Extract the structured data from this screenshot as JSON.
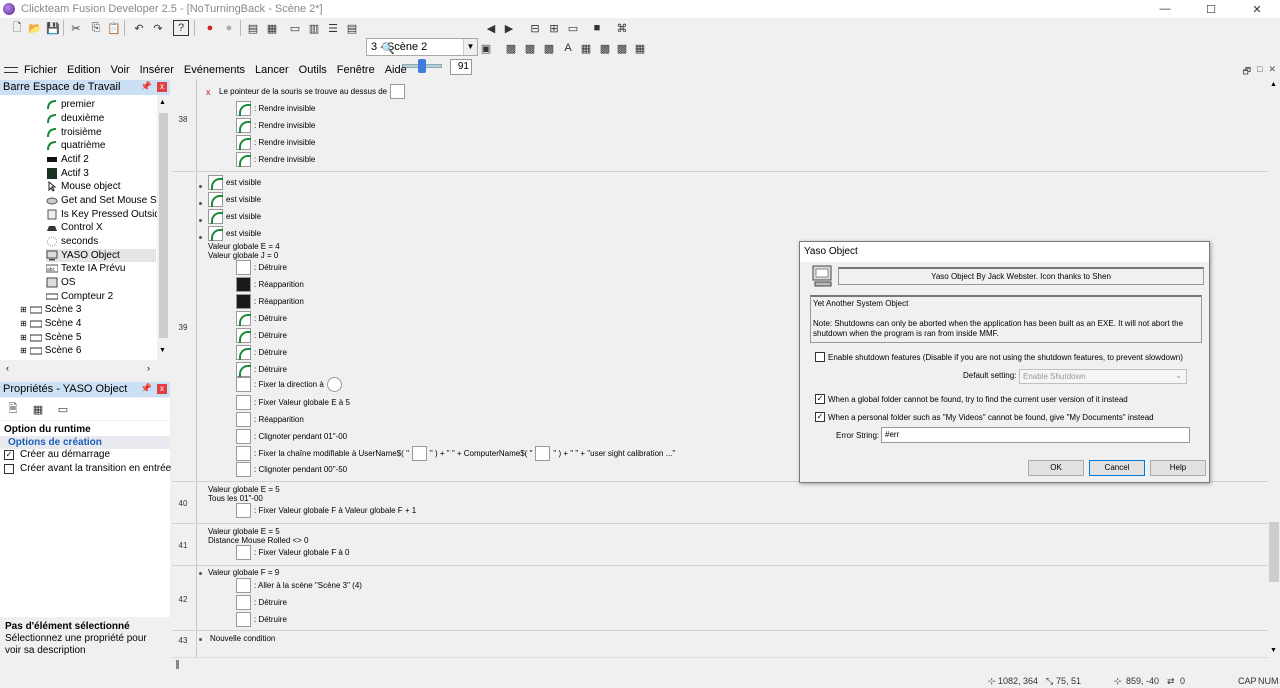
{
  "window": {
    "title": "Clickteam Fusion Developer 2.5 - [NoTurningBack - Scène 2*]",
    "minimize": "—",
    "maximize": "☐",
    "close": "✕"
  },
  "toolbar": {
    "scene_selector": "3 - Scène 2",
    "zoom_value": "91"
  },
  "menu": {
    "items": [
      "Fichier",
      "Edition",
      "Voir",
      "Insérer",
      "Evénements",
      "Lancer",
      "Outils",
      "Fenêtre",
      "Aide"
    ]
  },
  "workspace": {
    "title": "Barre Espace de Travail",
    "items": [
      {
        "label": "premier",
        "icon": "green-arc-icon"
      },
      {
        "label": "deuxième",
        "icon": "green-arc-icon"
      },
      {
        "label": "troisième",
        "icon": "green-arc-icon"
      },
      {
        "label": "quatrième",
        "icon": "green-arc-icon"
      },
      {
        "label": "Actif 2",
        "icon": "black-rect-icon"
      },
      {
        "label": "Actif 3",
        "icon": "dark-square-icon"
      },
      {
        "label": "Mouse object",
        "icon": "mouse-icon"
      },
      {
        "label": "Get and Set Mouse Spe",
        "icon": "mouse-pointer-icon"
      },
      {
        "label": "Is Key Pressed Outside",
        "icon": "key-icon"
      },
      {
        "label": "Control X",
        "icon": "control-icon"
      },
      {
        "label": "seconds",
        "icon": "dotted-circle-icon"
      },
      {
        "label": "YASO Object",
        "icon": "computer-icon"
      },
      {
        "label": "Texte IA Prévu",
        "icon": "text-icon"
      },
      {
        "label": "OS",
        "icon": "os-icon"
      },
      {
        "label": "Compteur 2",
        "icon": "counter-icon"
      },
      {
        "label": "Scène 3",
        "icon": "scene-icon"
      },
      {
        "label": "Scène 4",
        "icon": "scene-icon"
      },
      {
        "label": "Scène 5",
        "icon": "scene-icon"
      },
      {
        "label": "Scène 6",
        "icon": "scene-icon"
      }
    ]
  },
  "properties": {
    "title": "Propriétés - YASO Object",
    "section_runtime": "Option du runtime",
    "section_creation": "Options de création",
    "opt_create_start": "Créer au démarrage",
    "opt_create_before": "Créer avant la transition en entrée",
    "footer_title": "Pas d'élément sélectionné",
    "footer_text": "Sélectionnez une propriété pour voir sa description"
  },
  "events": {
    "row38": {
      "num": "38",
      "condition": "Le pointeur de la souris se trouve au dessus de",
      "actions": [
        ": Rendre invisible",
        ": Rendre invisible",
        ": Rendre invisible",
        ": Rendre invisible"
      ]
    },
    "row39": {
      "num": "39",
      "conditions": [
        "est visible",
        "est visible",
        "est visible",
        "est visible",
        "Valeur globale E = 4",
        "Valeur globale J = 0"
      ],
      "actions": [
        ": Détruire",
        ": Réapparition",
        ": Réapparition",
        ": Détruire",
        ": Détruire",
        ": Détruire",
        ": Détruire",
        ": Fixer la direction à",
        ": Fixer Valeur globale E à 5",
        ": Réapparition",
        ": Clignoter pendant 01\"-00",
        ": Fixer la chaîne modifiable à UserName$( \"",
        "\" ) + \" \" + ComputerName$( \"",
        "\" ) + \" \" + \"user sight calibration ...\"",
        ": Clignoter pendant 00\"-50"
      ]
    },
    "row40": {
      "num": "40",
      "conditions": [
        "Valeur globale E = 5",
        "Tous les 01\"-00"
      ],
      "action": ": Fixer Valeur globale F à Valeur globale F + 1"
    },
    "row41": {
      "num": "41",
      "conditions": [
        "Valeur globale E = 5",
        "Distance Mouse Rolled <> 0"
      ],
      "action": ": Fixer Valeur globale F à 0"
    },
    "row42": {
      "num": "42",
      "condition": "Valeur globale F = 9",
      "actions": [
        ": Aller à la scène \"Scène 3\" (4)",
        ": Détruire",
        ": Détruire"
      ]
    },
    "row43": {
      "num": "43",
      "condition": "Nouvelle condition"
    }
  },
  "dialog": {
    "title": "Yaso Object",
    "banner": "Yaso Object By Jack Webster. Icon thanks to Shen",
    "desc_title": "Yet Another System Object",
    "desc_note": "Note: Shutdowns can only be aborted when the application has been built as an EXE. It will not abort the shutdown when the program is ran from inside MMF.",
    "chk_shutdown": "Enable shutdown features (Disable if you are not using the shutdown features, to prevent slowdown)",
    "default_label": "Default setting:",
    "default_value": "Enable Shutdown",
    "chk_global": "When a global folder cannot be found, try to find the current user version of it instead",
    "chk_personal": "When a personal folder such as \"My Videos\" cannot be found, give \"My Documents\" instead",
    "error_label": "Error String:",
    "error_value": "#err",
    "ok": "OK",
    "cancel": "Cancel",
    "help": "Help"
  },
  "statusbar": {
    "coords": "1082, 364",
    "size": "75, 51",
    "mouse": "859, -40",
    "count": "0",
    "caps": "CAP",
    "num": "NUM"
  }
}
